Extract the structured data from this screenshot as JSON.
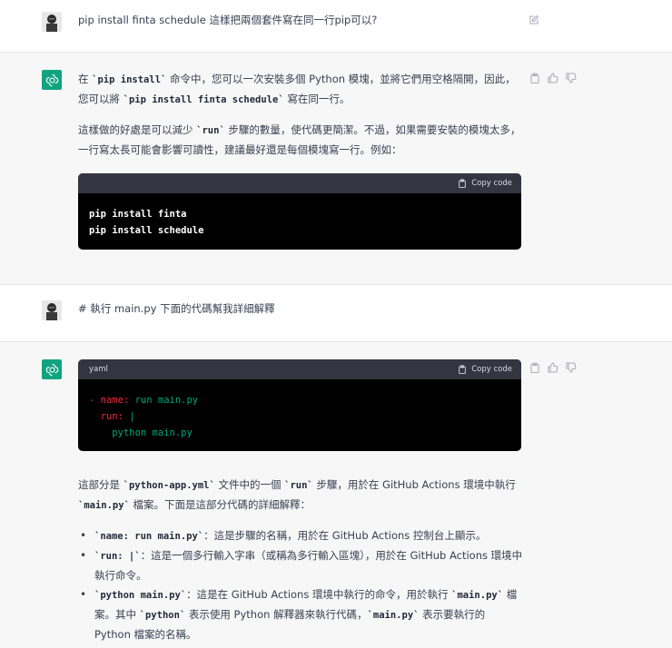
{
  "turns": [
    {
      "role": "user",
      "text": "pip install finta schedule 這樣把兩個套件寫在同一行pip可以?"
    },
    {
      "role": "assistant",
      "para1": {
        "t1": "在 ",
        "c1": "`pip install`",
        "t2": " 命令中，您可以一次安裝多個 Python 模塊，並將它們用空格隔開，因此，您可以將 ",
        "c2": "`pip install finta schedule`",
        "t3": " 寫在同一行。"
      },
      "para2": {
        "t1": "這樣做的好處是可以減少 ",
        "c1": "`run`",
        "t2": " 步驟的數量，使代碼更簡潔。不過，如果需要安裝的模塊太多，一行寫太長可能會影響可讀性，建議最好還是每個模塊寫一行。例如："
      },
      "code": {
        "language": "",
        "copy_label": "Copy code",
        "lines": [
          "pip install finta",
          "pip install schedule"
        ]
      }
    },
    {
      "role": "user",
      "text": "# 執行 main.py 下面的代碼幫我詳細解釋"
    },
    {
      "role": "assistant",
      "code": {
        "language": "yaml",
        "copy_label": "Copy code",
        "lines": [
          {
            "dash": "- ",
            "key": "name:",
            "value": " run main.py"
          },
          {
            "indent": "  ",
            "key": "run:",
            "value": " |"
          },
          {
            "indent": "    ",
            "value": "python main.py"
          }
        ]
      },
      "para1": {
        "t1": "這部分是 ",
        "c1": "`python-app.yml`",
        "t2": " 文件中的一個 ",
        "c2": "`run`",
        "t3": " 步驟，用於在 GitHub Actions 環境中執行 ",
        "c3": "`main.py`",
        "t4": " 檔案。下面是這部分代碼的詳細解釋："
      },
      "bullets": [
        {
          "c1": "`name: run main.py`",
          "t1": "：這是步驟的名稱，用於在 GitHub Actions 控制台上顯示。"
        },
        {
          "c1": "`run: |`",
          "t1": "：這是一個多行輸入字串（或稱為多行輸入區塊），用於在 GitHub Actions 環境中執行命令。"
        },
        {
          "c1": "`python main.py`",
          "t1": "：這是在 GitHub Actions 環境中執行的命令，用於執行 ",
          "c2": "`main.py`",
          "t2": " 檔案。其中 ",
          "c3": "`python`",
          "t3": " 表示使用 Python 解釋器來執行代碼，",
          "c4": "`main.py`",
          "t4": " 表示要執行的 Python 檔案的名稱。"
        }
      ]
    }
  ],
  "colors": {
    "assistant_bg": "#f7f7f8",
    "avatar_green": "#10a37f",
    "code_bg": "#000000",
    "code_header": "#343541",
    "yaml_key": "#f22c3d",
    "yaml_value": "#00a67d"
  },
  "icons": [
    "user-avatar",
    "assistant-logo-icon",
    "edit-icon",
    "clipboard-icon",
    "thumbs-up-icon",
    "thumbs-down-icon",
    "copy-icon"
  ]
}
